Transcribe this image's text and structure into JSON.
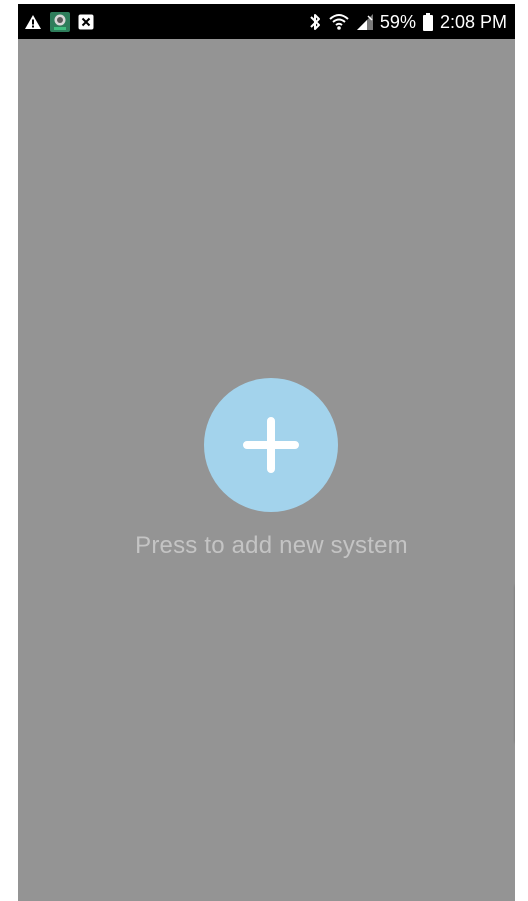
{
  "status_bar": {
    "battery_percent": "59%",
    "time": "2:08 PM",
    "left_icons": [
      "warning-icon",
      "app-notification-icon",
      "close-notification-icon"
    ],
    "right_icons": [
      "bluetooth-icon",
      "wifi-icon",
      "signal-icon",
      "battery-icon"
    ]
  },
  "main": {
    "add_prompt": "Press to add new system"
  },
  "colors": {
    "background": "#949494",
    "accent": "#a3d3ec",
    "prompt_text": "#c4c4c4"
  }
}
